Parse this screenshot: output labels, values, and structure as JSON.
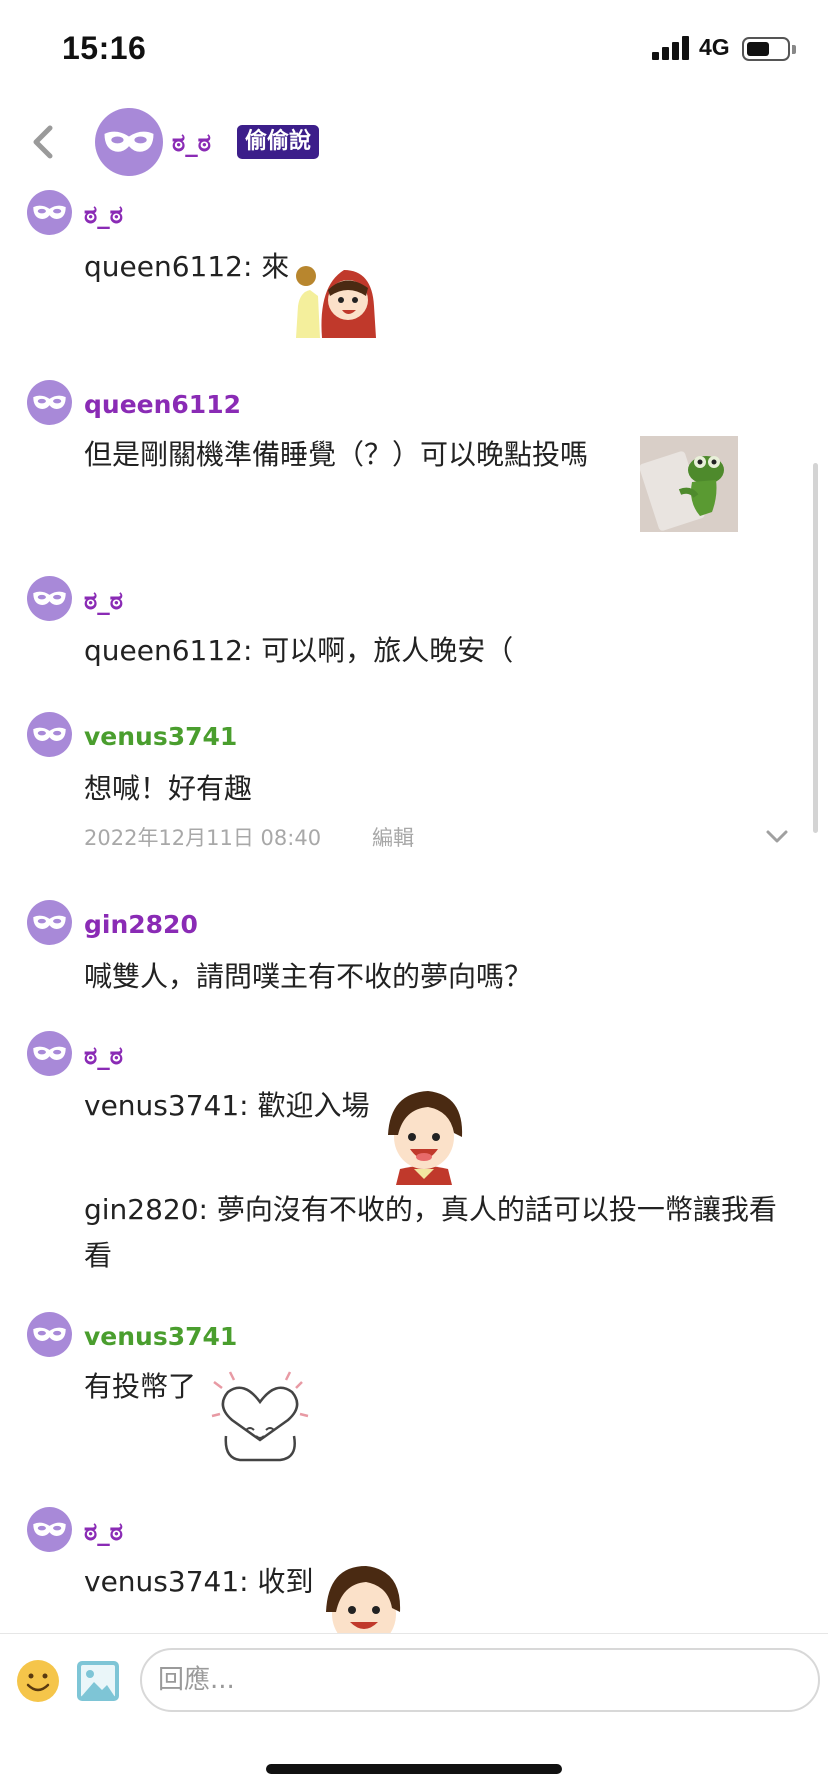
{
  "status_bar": {
    "time": "15:16",
    "network": "4G",
    "battery_level": 0.55
  },
  "header": {
    "back_icon": "chevron-left-icon",
    "title": "ಠ_ಠ",
    "badge": "偷偷說"
  },
  "messages": [
    {
      "name": "ಠ_ಠ",
      "text": "queen6112: 來"
    },
    {
      "name": "queen6112",
      "text": "但是剛關機準備睡覺（？）可以晚點投嗎"
    },
    {
      "name": "ಠ_ಠ",
      "text": "queen6112: 可以啊，旅人晚安（"
    },
    {
      "name": "venus3741",
      "text": "想喊！好有趣",
      "timestamp": "2022年12月11日 08:40",
      "edit_label": "編輯"
    },
    {
      "name": "gin2820",
      "text": "喊雙人，請問噗主有不收的夢向嗎？"
    },
    {
      "name": "ಠ_ಠ",
      "text": "venus3741: 歡迎入場",
      "text2": "gin2820: 夢向沒有不收的，真人的話可以投一幣讓我看看"
    },
    {
      "name": "venus3741",
      "text": "有投幣了"
    },
    {
      "name": "ಠ_ಠ",
      "text": "venus3741: 收到"
    }
  ],
  "input": {
    "placeholder": "回應...",
    "value": ""
  },
  "colors": {
    "accent_purple": "#8a2bb5",
    "user_green": "#4a9e2e",
    "badge_bg": "#3c1e8a",
    "avatar_bg": "#a889d8"
  }
}
